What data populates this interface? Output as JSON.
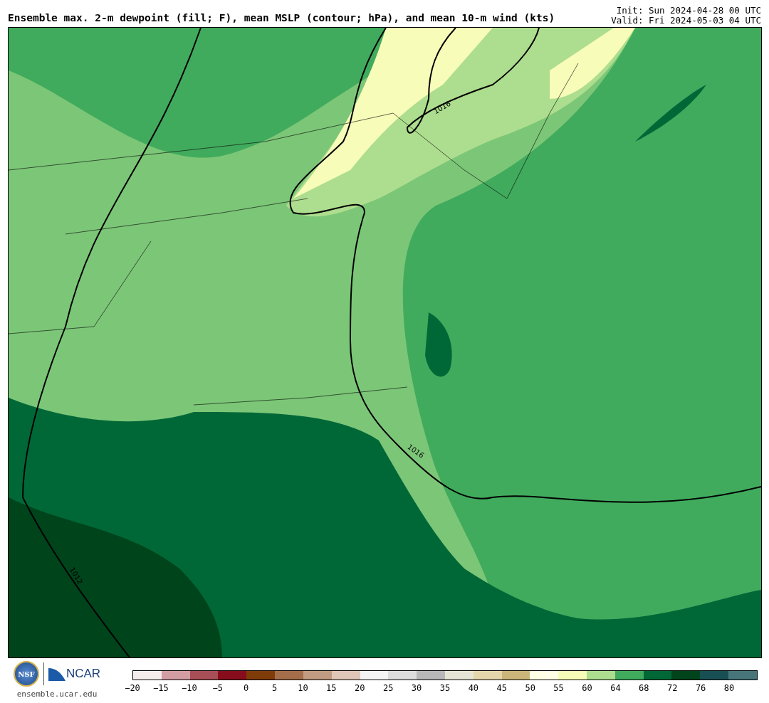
{
  "title": "Ensemble max. 2-m dewpoint (fill; F), mean MSLP (contour; hPa), and mean 10-m wind (kts)",
  "init": "Init: Sun 2024-04-28 00 UTC",
  "valid": "Valid: Fri 2024-05-03 04 UTC",
  "map": {
    "contour_labels": [
      "1016",
      "1016",
      "1012"
    ]
  },
  "footer": {
    "nsf": "NSF",
    "ncar": "NCAR",
    "url": "ensemble.ucar.edu"
  },
  "colorbar": {
    "segments": [
      {
        "color": "#f5ecec"
      },
      {
        "color": "#d29ea3"
      },
      {
        "color": "#a84e57"
      },
      {
        "color": "#870c1c"
      },
      {
        "color": "#7f3b08"
      },
      {
        "color": "#a56e4a"
      },
      {
        "color": "#c29c82"
      },
      {
        "color": "#e0c6b6"
      },
      {
        "color": "#f4f4f4"
      },
      {
        "color": "#dcdcdc"
      },
      {
        "color": "#b8b8b8"
      },
      {
        "color": "#e6e4d4"
      },
      {
        "color": "#e4d5ab"
      },
      {
        "color": "#cbb57a"
      },
      {
        "color": "#ffffe5"
      },
      {
        "color": "#f7fcb9"
      },
      {
        "color": "#addd8e"
      },
      {
        "color": "#41ab5d"
      },
      {
        "color": "#006837"
      },
      {
        "color": "#00441b"
      },
      {
        "color": "#174f55"
      },
      {
        "color": "#477579"
      }
    ],
    "ticks": [
      "−20",
      "−15",
      "−10",
      "−5",
      "0",
      "5",
      "10",
      "15",
      "20",
      "25",
      "30",
      "35",
      "40",
      "45",
      "50",
      "55",
      "60",
      "64",
      "68",
      "72",
      "76",
      "80"
    ]
  }
}
